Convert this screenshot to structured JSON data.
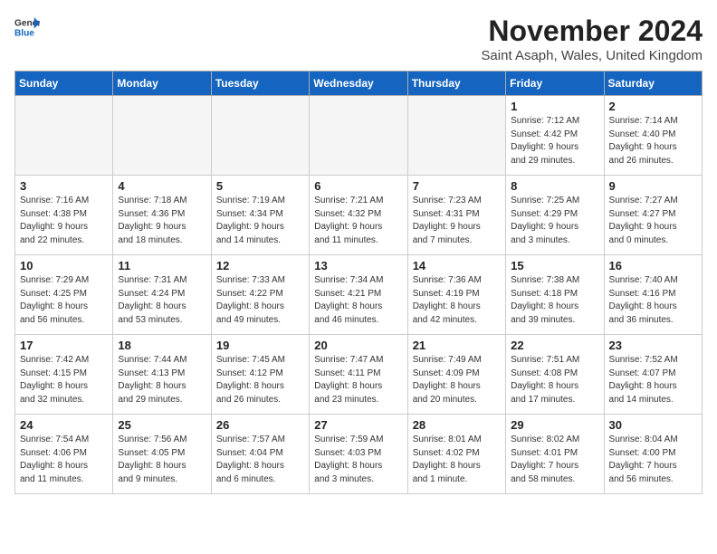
{
  "header": {
    "logo_line1": "General",
    "logo_line2": "Blue",
    "month_title": "November 2024",
    "location": "Saint Asaph, Wales, United Kingdom"
  },
  "columns": [
    "Sunday",
    "Monday",
    "Tuesday",
    "Wednesday",
    "Thursday",
    "Friday",
    "Saturday"
  ],
  "weeks": [
    [
      {
        "day": "",
        "info": ""
      },
      {
        "day": "",
        "info": ""
      },
      {
        "day": "",
        "info": ""
      },
      {
        "day": "",
        "info": ""
      },
      {
        "day": "",
        "info": ""
      },
      {
        "day": "1",
        "info": "Sunrise: 7:12 AM\nSunset: 4:42 PM\nDaylight: 9 hours\nand 29 minutes."
      },
      {
        "day": "2",
        "info": "Sunrise: 7:14 AM\nSunset: 4:40 PM\nDaylight: 9 hours\nand 26 minutes."
      }
    ],
    [
      {
        "day": "3",
        "info": "Sunrise: 7:16 AM\nSunset: 4:38 PM\nDaylight: 9 hours\nand 22 minutes."
      },
      {
        "day": "4",
        "info": "Sunrise: 7:18 AM\nSunset: 4:36 PM\nDaylight: 9 hours\nand 18 minutes."
      },
      {
        "day": "5",
        "info": "Sunrise: 7:19 AM\nSunset: 4:34 PM\nDaylight: 9 hours\nand 14 minutes."
      },
      {
        "day": "6",
        "info": "Sunrise: 7:21 AM\nSunset: 4:32 PM\nDaylight: 9 hours\nand 11 minutes."
      },
      {
        "day": "7",
        "info": "Sunrise: 7:23 AM\nSunset: 4:31 PM\nDaylight: 9 hours\nand 7 minutes."
      },
      {
        "day": "8",
        "info": "Sunrise: 7:25 AM\nSunset: 4:29 PM\nDaylight: 9 hours\nand 3 minutes."
      },
      {
        "day": "9",
        "info": "Sunrise: 7:27 AM\nSunset: 4:27 PM\nDaylight: 9 hours\nand 0 minutes."
      }
    ],
    [
      {
        "day": "10",
        "info": "Sunrise: 7:29 AM\nSunset: 4:25 PM\nDaylight: 8 hours\nand 56 minutes."
      },
      {
        "day": "11",
        "info": "Sunrise: 7:31 AM\nSunset: 4:24 PM\nDaylight: 8 hours\nand 53 minutes."
      },
      {
        "day": "12",
        "info": "Sunrise: 7:33 AM\nSunset: 4:22 PM\nDaylight: 8 hours\nand 49 minutes."
      },
      {
        "day": "13",
        "info": "Sunrise: 7:34 AM\nSunset: 4:21 PM\nDaylight: 8 hours\nand 46 minutes."
      },
      {
        "day": "14",
        "info": "Sunrise: 7:36 AM\nSunset: 4:19 PM\nDaylight: 8 hours\nand 42 minutes."
      },
      {
        "day": "15",
        "info": "Sunrise: 7:38 AM\nSunset: 4:18 PM\nDaylight: 8 hours\nand 39 minutes."
      },
      {
        "day": "16",
        "info": "Sunrise: 7:40 AM\nSunset: 4:16 PM\nDaylight: 8 hours\nand 36 minutes."
      }
    ],
    [
      {
        "day": "17",
        "info": "Sunrise: 7:42 AM\nSunset: 4:15 PM\nDaylight: 8 hours\nand 32 minutes."
      },
      {
        "day": "18",
        "info": "Sunrise: 7:44 AM\nSunset: 4:13 PM\nDaylight: 8 hours\nand 29 minutes."
      },
      {
        "day": "19",
        "info": "Sunrise: 7:45 AM\nSunset: 4:12 PM\nDaylight: 8 hours\nand 26 minutes."
      },
      {
        "day": "20",
        "info": "Sunrise: 7:47 AM\nSunset: 4:11 PM\nDaylight: 8 hours\nand 23 minutes."
      },
      {
        "day": "21",
        "info": "Sunrise: 7:49 AM\nSunset: 4:09 PM\nDaylight: 8 hours\nand 20 minutes."
      },
      {
        "day": "22",
        "info": "Sunrise: 7:51 AM\nSunset: 4:08 PM\nDaylight: 8 hours\nand 17 minutes."
      },
      {
        "day": "23",
        "info": "Sunrise: 7:52 AM\nSunset: 4:07 PM\nDaylight: 8 hours\nand 14 minutes."
      }
    ],
    [
      {
        "day": "24",
        "info": "Sunrise: 7:54 AM\nSunset: 4:06 PM\nDaylight: 8 hours\nand 11 minutes."
      },
      {
        "day": "25",
        "info": "Sunrise: 7:56 AM\nSunset: 4:05 PM\nDaylight: 8 hours\nand 9 minutes."
      },
      {
        "day": "26",
        "info": "Sunrise: 7:57 AM\nSunset: 4:04 PM\nDaylight: 8 hours\nand 6 minutes."
      },
      {
        "day": "27",
        "info": "Sunrise: 7:59 AM\nSunset: 4:03 PM\nDaylight: 8 hours\nand 3 minutes."
      },
      {
        "day": "28",
        "info": "Sunrise: 8:01 AM\nSunset: 4:02 PM\nDaylight: 8 hours\nand 1 minute."
      },
      {
        "day": "29",
        "info": "Sunrise: 8:02 AM\nSunset: 4:01 PM\nDaylight: 7 hours\nand 58 minutes."
      },
      {
        "day": "30",
        "info": "Sunrise: 8:04 AM\nSunset: 4:00 PM\nDaylight: 7 hours\nand 56 minutes."
      }
    ]
  ]
}
